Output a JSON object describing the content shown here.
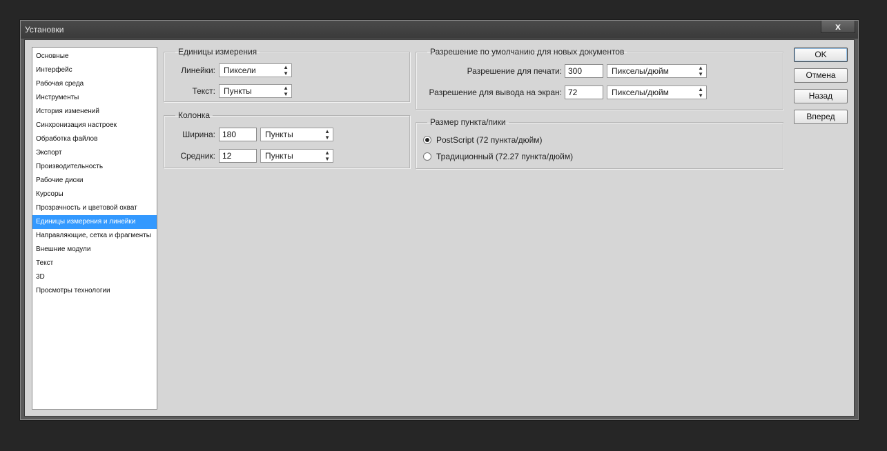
{
  "window": {
    "title": "Установки",
    "close_label": "x"
  },
  "sidebar": {
    "items": [
      {
        "label": "Основные"
      },
      {
        "label": "Интерфейс"
      },
      {
        "label": "Рабочая среда"
      },
      {
        "label": "Инструменты"
      },
      {
        "label": "История изменений"
      },
      {
        "label": "Синхронизация настроек"
      },
      {
        "label": "Обработка файлов"
      },
      {
        "label": "Экспорт"
      },
      {
        "label": "Производительность"
      },
      {
        "label": "Рабочие диски"
      },
      {
        "label": "Курсоры"
      },
      {
        "label": "Прозрачность и цветовой охват"
      },
      {
        "label": "Единицы измерения и линейки"
      },
      {
        "label": "Направляющие, сетка и фрагменты"
      },
      {
        "label": "Внешние модули"
      },
      {
        "label": "Текст"
      },
      {
        "label": "3D"
      },
      {
        "label": "Просмотры технологии"
      }
    ],
    "selected_index": 12
  },
  "units": {
    "legend": "Единицы измерения",
    "rulers_label": "Линейки:",
    "rulers_value": "Пиксели",
    "type_label": "Текст:",
    "type_value": "Пункты"
  },
  "column": {
    "legend": "Колонка",
    "width_label": "Ширина:",
    "width_value": "180",
    "width_unit": "Пункты",
    "gutter_label": "Средник:",
    "gutter_value": "12",
    "gutter_unit": "Пункты"
  },
  "resolution": {
    "legend": "Разрешение по умолчанию для новых документов",
    "print_label": "Разрешение для печати:",
    "print_value": "300",
    "print_unit": "Пикселы/дюйм",
    "screen_label": "Разрешение для вывода на экран:",
    "screen_value": "72",
    "screen_unit": "Пикселы/дюйм"
  },
  "point_size": {
    "legend": "Размер пункта/пики",
    "options": [
      {
        "label": "PostScript (72 пункта/дюйм)",
        "checked": true
      },
      {
        "label": "Традиционный (72.27 пункта/дюйм)",
        "checked": false
      }
    ]
  },
  "buttons": {
    "ok": "OK",
    "cancel": "Отмена",
    "prev": "Назад",
    "next": "Вперед"
  }
}
